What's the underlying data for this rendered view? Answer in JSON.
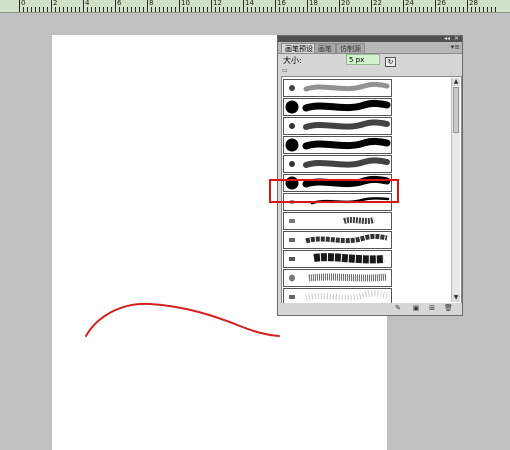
{
  "ruler": {
    "labels": [
      "0",
      "2",
      "4",
      "6",
      "8",
      "10",
      "12",
      "14",
      "16",
      "18",
      "20",
      "22",
      "24",
      "26",
      "28"
    ]
  },
  "panel": {
    "tabs": [
      {
        "label": "画笔预设",
        "active": true
      },
      {
        "label": "画笔",
        "active": false
      },
      {
        "label": "仿制源",
        "active": false
      }
    ],
    "menu_icon": "panel-menu-icon",
    "size_label": "大小:",
    "size_value": "5 px",
    "reset_icon": "reset-brush-icon",
    "brushes": [
      {
        "kind": "soft-small"
      },
      {
        "kind": "hard-large"
      },
      {
        "kind": "soft-medium"
      },
      {
        "kind": "hard-large"
      },
      {
        "kind": "soft-medium"
      },
      {
        "kind": "hard-large"
      },
      {
        "kind": "pressure-taper",
        "selected": true
      },
      {
        "kind": "chalk"
      },
      {
        "kind": "charcoal"
      },
      {
        "kind": "dry-brush"
      },
      {
        "kind": "wet-brush"
      },
      {
        "kind": "faint-texture"
      }
    ],
    "bottom_icons": [
      "toggle-brush-panel-icon",
      "new-preset-icon",
      "delete-icon"
    ]
  },
  "colors": {
    "highlight": "#d91616",
    "stroke": "#d32020",
    "canvas": "#ffffff",
    "workspace": "#c0c0c0",
    "ruler": "#cfe1c6"
  }
}
